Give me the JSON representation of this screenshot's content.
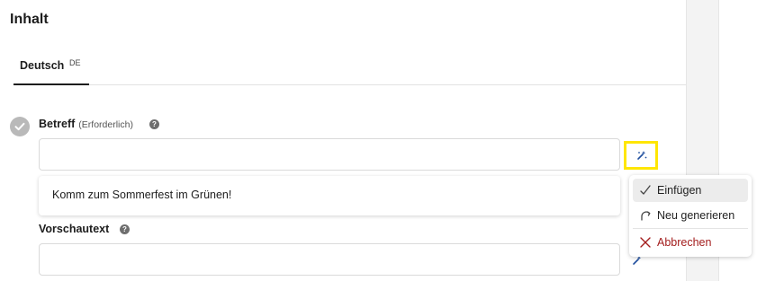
{
  "section": {
    "title": "Inhalt"
  },
  "tabs": [
    {
      "label": "Deutsch",
      "lang": "DE",
      "active": true
    }
  ],
  "fields": {
    "subject": {
      "label": "Betreff",
      "required_note": "(Erforderlich)",
      "value": "",
      "help_icon": "question-icon"
    },
    "preview": {
      "label": "Vorschautext",
      "value": "",
      "help_icon": "question-icon"
    }
  },
  "suggestion": {
    "text": "Komm zum Sommerfest im Grünen!"
  },
  "ai_menu": {
    "items": [
      {
        "label": "Einfügen",
        "icon": "check-icon",
        "active": true
      },
      {
        "label": "Neu generieren",
        "icon": "refresh-icon"
      },
      {
        "label": "Abbrechen",
        "icon": "close-icon",
        "danger": true
      }
    ]
  },
  "colors": {
    "highlight": "#ffe600",
    "ai_icon": "#1f4e9e",
    "danger": "#a31d1d",
    "completed_check": "#b9b9b9"
  }
}
